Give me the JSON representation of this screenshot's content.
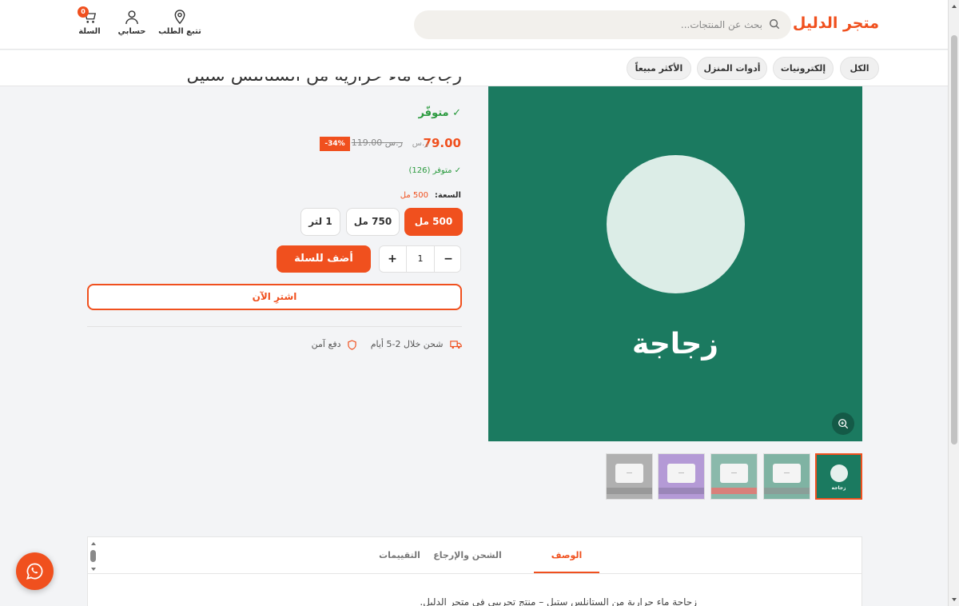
{
  "header": {
    "logo": "متجر الدليل",
    "search_placeholder": "بحث عن المنتجات...",
    "track_label": "تتبع الطلب",
    "account_label": "حسابي",
    "cart_label": "السلة",
    "cart_count": "0"
  },
  "categories": [
    "الكل",
    "إلكترونيات",
    "أدوات المنزل",
    "الأكثر مبيعاً"
  ],
  "product": {
    "title": "زجاجة ماء حرارية من الستانلس ستيل",
    "availability": "✓ متوفّر",
    "price": "79.00",
    "currency": "ر.س",
    "old_price": "119.00 ر.س",
    "discount": "-34%",
    "stock_count": "✓ متوفر (126)",
    "capacity_label": "السعة:",
    "capacity_value": "500 مل",
    "options": [
      "500 مل",
      "750 مل",
      "1 لتر"
    ],
    "selected_option": "500 مل",
    "quantity": "1",
    "qty_minus": "−",
    "qty_plus": "+",
    "add_to_cart": "أضف للسلة",
    "buy_now": "اشترِ الآن",
    "shipping": "شحن خلال 2-5 أيام",
    "secure_payment": "دفع آمن",
    "image_text": "زجاجة"
  },
  "thumbnails": {
    "active_label": "زجاجة",
    "colors": [
      "#1b7a60",
      "#7fb3a3",
      "#8ab9ab",
      "#b49ad6",
      "#b0b0b0"
    ]
  },
  "tabs": [
    "الوصف",
    "الشحن والإرجاع",
    "التقييمات"
  ],
  "description": "زجاجة ماء حرارية من الستانلس ستيل – منتج تجريبي في متجر الدليل.",
  "colors": {
    "accent": "#f0501e",
    "success": "#2a9a3e",
    "image_bg": "#1b7a60"
  }
}
